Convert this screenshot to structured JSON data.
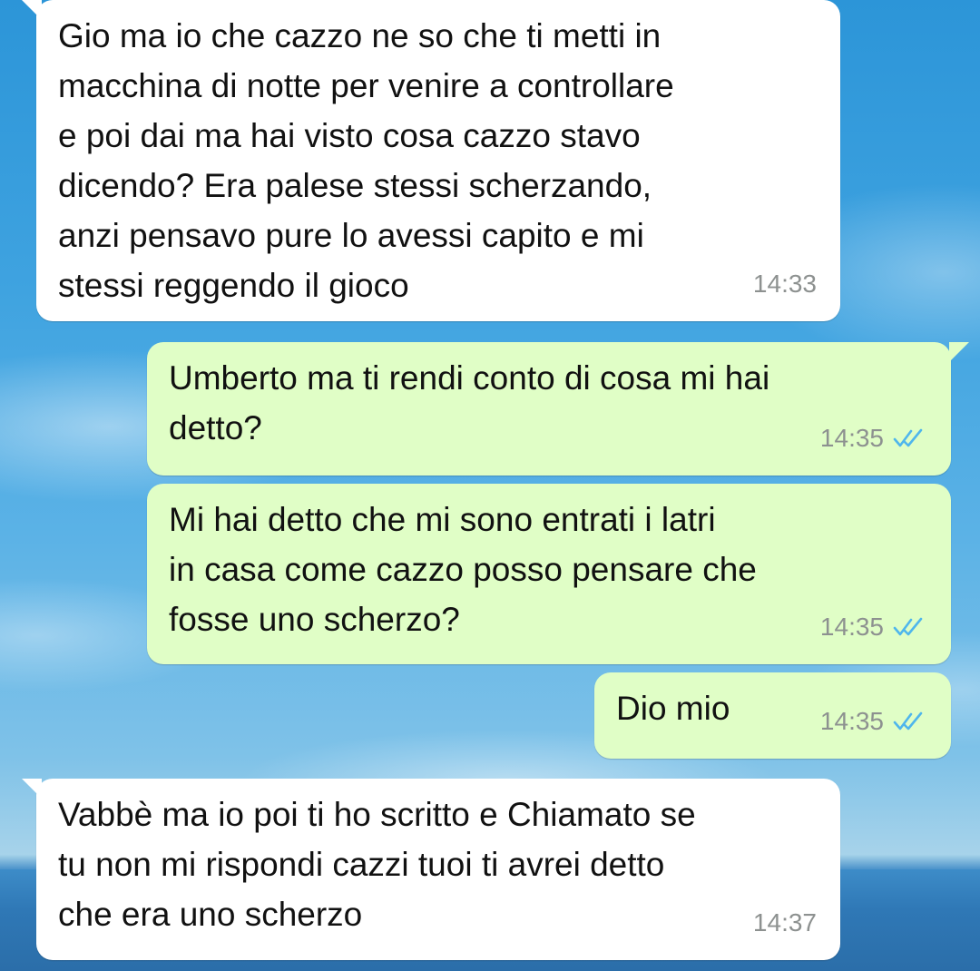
{
  "messages": [
    {
      "direction": "incoming",
      "text": "Gio ma io che cazzo ne so che ti metti in\nmacchina di notte per venire a controllare\ne poi dai ma hai visto cosa cazzo stavo\ndicendo? Era palese stessi scherzando,\nanzi pensavo pure lo avessi capito e mi\nstessi reggendo il gioco",
      "time": "14:33"
    },
    {
      "direction": "outgoing",
      "text": "Umberto ma ti rendi conto di cosa mi hai\ndetto?",
      "time": "14:35",
      "status": "read"
    },
    {
      "direction": "outgoing",
      "text": "Mi hai detto che mi sono entrati i latri\nin casa come cazzo posso pensare che\nfosse uno scherzo?",
      "time": "14:35",
      "status": "read"
    },
    {
      "direction": "outgoing",
      "text": "Dio mio",
      "time": "14:35",
      "status": "read"
    },
    {
      "direction": "incoming",
      "text": "Vabbè ma io poi ti ho scritto e Chiamato se\ntu non mi rispondi cazzi tuoi ti avrei detto\nche era uno scherzo",
      "time": "14:37"
    }
  ],
  "colors": {
    "incoming_bubble": "#ffffff",
    "outgoing_bubble": "#e0fec6",
    "read_check": "#4fb6ec",
    "timestamp": "#8d9190"
  },
  "icons": {
    "read_receipt": "double-check-icon"
  }
}
